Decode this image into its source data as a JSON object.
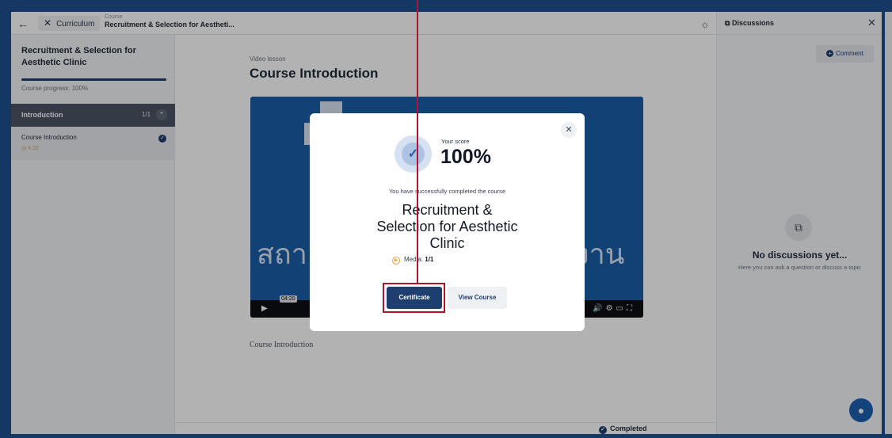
{
  "topbar": {
    "curriculum_label": "Curriculum",
    "course_label": "Course",
    "course_title": "Recruitment & Selection for Aestheti..."
  },
  "sidebar": {
    "title": "Recruitment & Selection for Aesthetic Clinic",
    "progress_percent": 100,
    "progress_text": "Course progress: 100%",
    "section": {
      "name": "Introduction",
      "count": "1/1"
    },
    "lessons": [
      {
        "name": "Course Introduction",
        "duration": "4.20",
        "completed": true
      }
    ]
  },
  "main": {
    "type_label": "Video lesson",
    "title": "Course Introduction",
    "video": {
      "time_tooltip": "04:20",
      "thai_left": "สถา",
      "thai_right": "งาน"
    },
    "caption": "Course Introduction",
    "status": "Completed"
  },
  "discussions": {
    "title": "Discussions",
    "comment_label": "Comment",
    "empty_title": "No discussions yet...",
    "empty_sub": "Here you can ask a question or discuss a topic"
  },
  "modal": {
    "score_label": "Your score",
    "score_value": "100%",
    "success_text": "You have successfully completed the course",
    "course_name": "Recruitment & Selection for Aesthetic Clinic",
    "media_label": "Media:",
    "media_value": "1/1",
    "certificate_label": "Certificate",
    "view_course_label": "View Course"
  },
  "colors": {
    "accent": "#1d3e6e",
    "frame": "#1f4f8f",
    "highlight": "#b3142b",
    "warning": "#e5a140"
  }
}
